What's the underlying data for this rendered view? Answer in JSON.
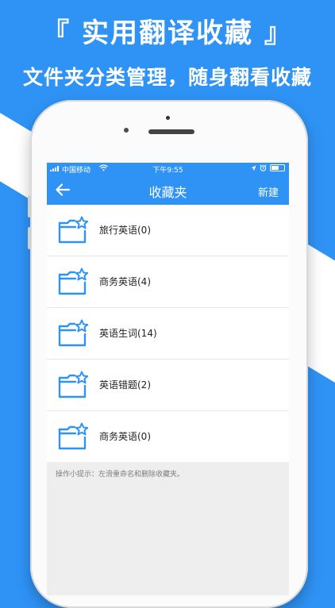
{
  "headline": "『 实用翻译收藏 』",
  "subline": "文件夹分类管理，随身翻看收藏",
  "status_bar": {
    "carrier": "中国移动",
    "wifi_icon": "wifi-icon",
    "time": "下午9:55",
    "right_icons": [
      "location-arrow-icon",
      "alarm-icon",
      "battery-icon"
    ],
    "battery_level": 0.6
  },
  "nav": {
    "back_icon": "back-arrow-icon",
    "title": "收藏夹",
    "new_label": "新建"
  },
  "folders": [
    {
      "name": "旅行英语(0)",
      "icon": "folder-star-icon"
    },
    {
      "name": "商务英语(4)",
      "icon": "folder-star-icon"
    },
    {
      "name": "英语生词(14)",
      "icon": "folder-star-icon"
    },
    {
      "name": "英语错题(2)",
      "icon": "folder-star-icon"
    },
    {
      "name": "商务英语(0)",
      "icon": "folder-star-icon"
    }
  ],
  "tip": "操作小提示：左滑重命名和删除收藏夹。",
  "colors": {
    "accent": "#2f93f5",
    "background": "#2f93f5",
    "icon_stroke": "#2f93f5",
    "list_bg": "#ffffff",
    "screen_bg": "#eeeeee"
  }
}
